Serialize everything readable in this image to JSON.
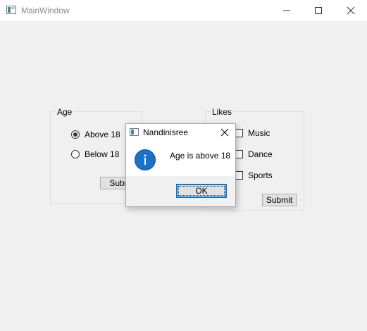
{
  "window": {
    "title": "MainWindow"
  },
  "age_group": {
    "title": "Age",
    "options": [
      {
        "label": "Above 18",
        "checked": true
      },
      {
        "label": "Below 18",
        "checked": false
      }
    ],
    "submit_label": "Submit"
  },
  "likes_group": {
    "title": "Likes",
    "options": [
      {
        "label": "Music",
        "checked": false
      },
      {
        "label": "Dance",
        "checked": false
      },
      {
        "label": "Sports",
        "checked": false
      }
    ],
    "submit_label": "Submit"
  },
  "message_box": {
    "title": "Nandinisree",
    "message": "Age is above 18",
    "icon": "info-icon",
    "ok_label": "OK",
    "accent_color": "#0078d7"
  }
}
